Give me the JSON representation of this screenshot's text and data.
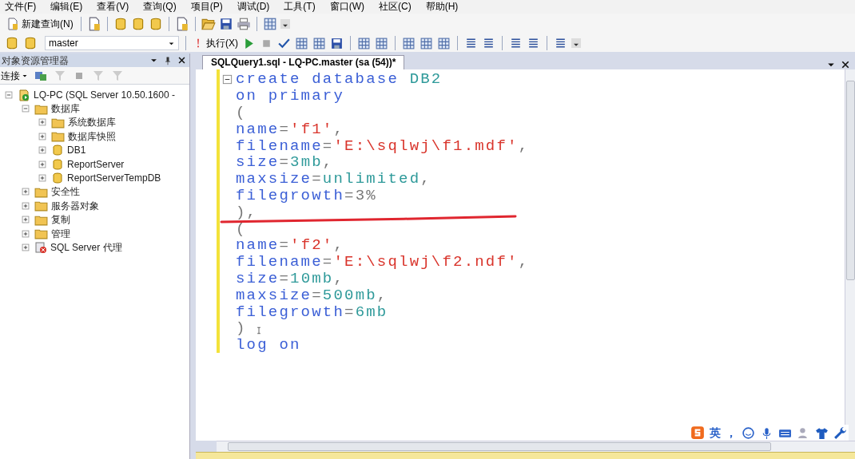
{
  "menu_bar": [
    "文件(F)",
    "编辑(E)",
    "查看(V)",
    "查询(Q)",
    "项目(P)",
    "调试(D)",
    "工具(T)",
    "窗口(W)",
    "社区(C)",
    "帮助(H)"
  ],
  "toolbar": {
    "new_query": "新建查询(N)"
  },
  "query_toolbar": {
    "database": "master",
    "execute": "执行(X)"
  },
  "object_explorer": {
    "title": "对象资源管理器",
    "connect": "连接",
    "tree": [
      {
        "label": "LQ-PC (SQL Server 10.50.1600 -",
        "kind": "server",
        "expanded": true,
        "children": [
          {
            "label": "数据库",
            "kind": "folder",
            "expanded": true,
            "children": [
              {
                "label": "系统数据库",
                "kind": "folder",
                "expanded": false
              },
              {
                "label": "数据库快照",
                "kind": "folder",
                "expanded": false
              },
              {
                "label": "DB1",
                "kind": "database",
                "expanded": false
              },
              {
                "label": "ReportServer",
                "kind": "database",
                "expanded": false
              },
              {
                "label": "ReportServerTempDB",
                "kind": "database",
                "expanded": false
              }
            ]
          },
          {
            "label": "安全性",
            "kind": "folder",
            "expanded": false
          },
          {
            "label": "服务器对象",
            "kind": "folder",
            "expanded": false
          },
          {
            "label": "复制",
            "kind": "folder",
            "expanded": false
          },
          {
            "label": "管理",
            "kind": "folder",
            "expanded": false
          },
          {
            "label": "SQL Server 代理",
            "kind": "agent",
            "expanded": false
          }
        ]
      }
    ]
  },
  "editor": {
    "tab": "SQLQuery1.sql - LQ-PC.master (sa (54))*",
    "lines": [
      [
        {
          "kind": "keyword",
          "text": "create database"
        },
        {
          "kind": "ident",
          "text": " DB2"
        }
      ],
      [
        {
          "kind": "keyword",
          "text": "on primary"
        }
      ],
      [
        {
          "kind": "punct",
          "text": "("
        }
      ],
      [
        {
          "kind": "keyword",
          "text": "name"
        },
        {
          "kind": "punct",
          "text": "="
        },
        {
          "kind": "string",
          "text": "'f1'"
        },
        {
          "kind": "punct",
          "text": ","
        }
      ],
      [
        {
          "kind": "keyword",
          "text": "filename"
        },
        {
          "kind": "punct",
          "text": "="
        },
        {
          "kind": "string",
          "text": "'E:\\sqlwj\\f1.mdf'"
        },
        {
          "kind": "punct",
          "text": ","
        }
      ],
      [
        {
          "kind": "keyword",
          "text": "size"
        },
        {
          "kind": "punct",
          "text": "="
        },
        {
          "kind": "ident",
          "text": "3mb"
        },
        {
          "kind": "punct",
          "text": ","
        }
      ],
      [
        {
          "kind": "keyword",
          "text": "maxsize"
        },
        {
          "kind": "punct",
          "text": "="
        },
        {
          "kind": "ident",
          "text": "unlimited"
        },
        {
          "kind": "punct",
          "text": ","
        }
      ],
      [
        {
          "kind": "keyword",
          "text": "filegrowth"
        },
        {
          "kind": "punct",
          "text": "=3%"
        }
      ],
      [
        {
          "kind": "punct",
          "text": "),"
        }
      ],
      [
        {
          "kind": "punct",
          "text": "("
        }
      ],
      [
        {
          "kind": "keyword",
          "text": "name"
        },
        {
          "kind": "punct",
          "text": "="
        },
        {
          "kind": "string",
          "text": "'f2'"
        },
        {
          "kind": "punct",
          "text": ","
        }
      ],
      [
        {
          "kind": "keyword",
          "text": "filename"
        },
        {
          "kind": "punct",
          "text": "="
        },
        {
          "kind": "string",
          "text": "'E:\\sqlwj\\f2.ndf'"
        },
        {
          "kind": "punct",
          "text": ","
        }
      ],
      [
        {
          "kind": "keyword",
          "text": "size"
        },
        {
          "kind": "punct",
          "text": "="
        },
        {
          "kind": "ident",
          "text": "10mb"
        },
        {
          "kind": "punct",
          "text": ","
        }
      ],
      [
        {
          "kind": "keyword",
          "text": "maxsize"
        },
        {
          "kind": "punct",
          "text": "="
        },
        {
          "kind": "ident",
          "text": "500mb"
        },
        {
          "kind": "punct",
          "text": ","
        }
      ],
      [
        {
          "kind": "keyword",
          "text": "filegrowth"
        },
        {
          "kind": "punct",
          "text": "="
        },
        {
          "kind": "ident",
          "text": "6mb"
        }
      ],
      [
        {
          "kind": "punct",
          "text": ")"
        }
      ],
      [
        {
          "kind": "keyword",
          "text": "log on"
        }
      ]
    ]
  },
  "ime_toolbar": {
    "mode": "英",
    "punctuation": "，"
  }
}
